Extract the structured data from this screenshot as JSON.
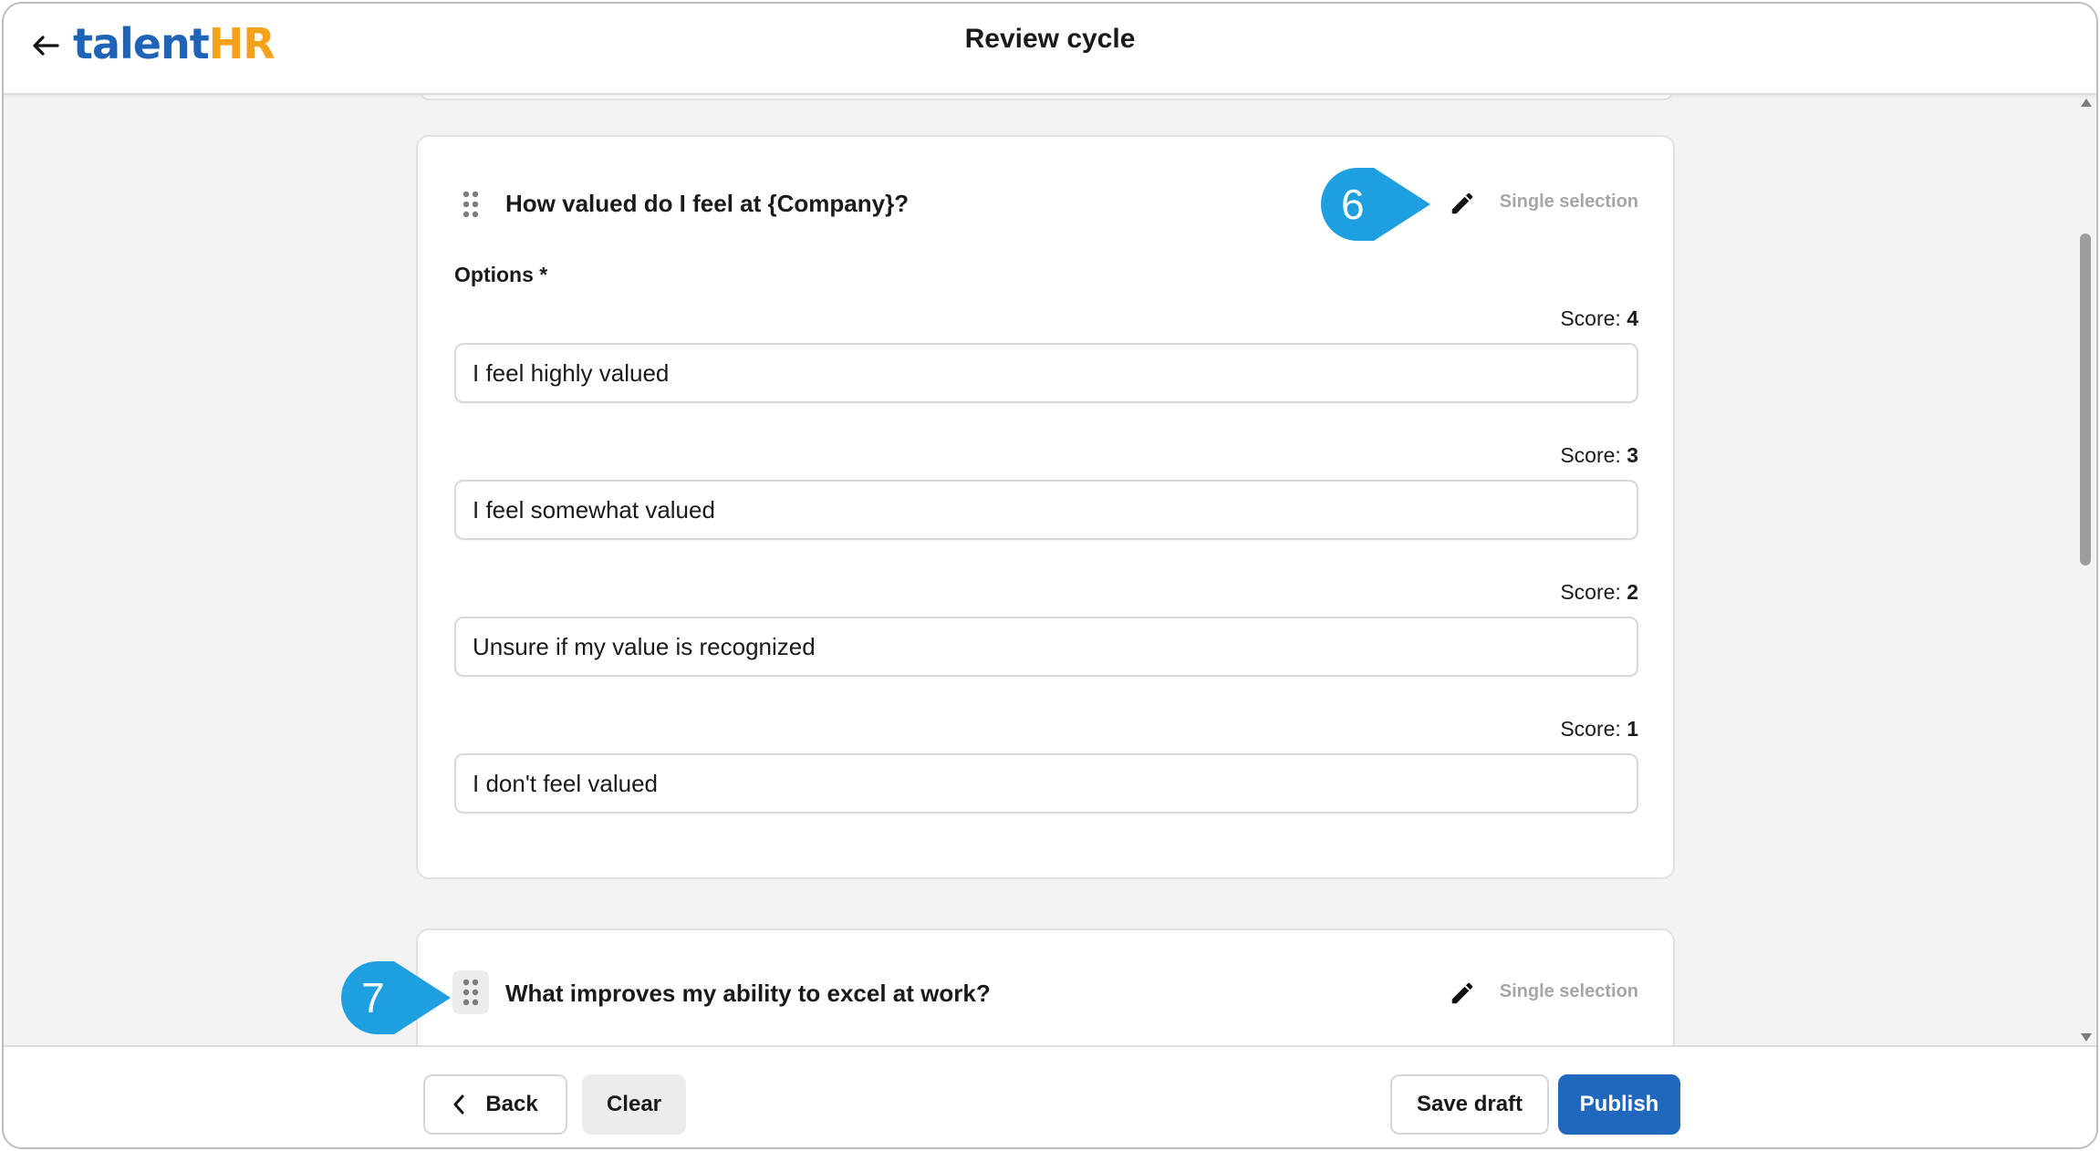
{
  "header": {
    "back_icon": "arrow-left-icon",
    "logo": {
      "part1": "talent",
      "part2": "HR"
    },
    "title": "Review cycle"
  },
  "questions": [
    {
      "title": "How valued do I feel at {Company}?",
      "type": "Single selection",
      "options_label": "Options *",
      "options": [
        {
          "score_label": "Score: ",
          "score": "4",
          "value": "I feel highly valued"
        },
        {
          "score_label": "Score: ",
          "score": "3",
          "value": "I feel somewhat valued"
        },
        {
          "score_label": "Score: ",
          "score": "2",
          "value": "Unsure if my value is recognized"
        },
        {
          "score_label": "Score: ",
          "score": "1",
          "value": "I don't feel valued"
        }
      ]
    },
    {
      "title": "What improves my ability to excel at work?",
      "type": "Single selection"
    }
  ],
  "callouts": [
    "6",
    "7"
  ],
  "footer": {
    "back_label": "Back",
    "clear_label": "Clear",
    "save_draft_label": "Save draft",
    "publish_label": "Publish"
  },
  "colors": {
    "brand_blue": "#1f63b6",
    "brand_orange": "#f4a11c",
    "primary_button": "#1f68be",
    "callout": "#1d9fe0"
  }
}
